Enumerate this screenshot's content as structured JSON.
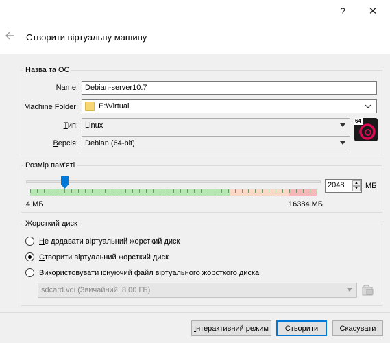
{
  "titlebar": {
    "help_label": "?",
    "close_label": "✕"
  },
  "header": {
    "back_icon": "back-arrow-icon",
    "title": "Створити віртуальну машину"
  },
  "name_os": {
    "legend": "Назва та ОС",
    "name_label": "Name:",
    "name_value": "Debian-server10.7",
    "folder_label": "Machine Folder:",
    "folder_value": "E:\\Virtual",
    "type_label": "Тип:",
    "type_value": "Linux",
    "version_label": "Версія:",
    "version_value": "Debian (64-bit)",
    "os_icon": "debian-64-icon",
    "os_badge": "64"
  },
  "memory": {
    "legend": "Розмір пам'яті",
    "value": "2048",
    "unit": "МБ",
    "min_label": "4 МБ",
    "max_label": "16384 МБ",
    "slider_fraction": 0.125
  },
  "disk": {
    "legend": "Жорсткий диск",
    "options": [
      {
        "label": "Не додавати віртуальний жорсткий диск",
        "selected": false
      },
      {
        "label": "Створити віртуальний жорсткий диск",
        "selected": true
      },
      {
        "label": "Використовувати існуючий файл віртуального жорсткого диска",
        "selected": false
      }
    ],
    "existing_file": "sdcard.vdi (Звичайний, 8,00 ГБ)"
  },
  "footer": {
    "expert_label": "Інтерактивний режим",
    "create_label": "Створити",
    "cancel_label": "Скасувати"
  },
  "colors": {
    "accent": "#0078d7",
    "slider_green": "#b8e6b4",
    "slider_red": "#f4b8b8"
  }
}
